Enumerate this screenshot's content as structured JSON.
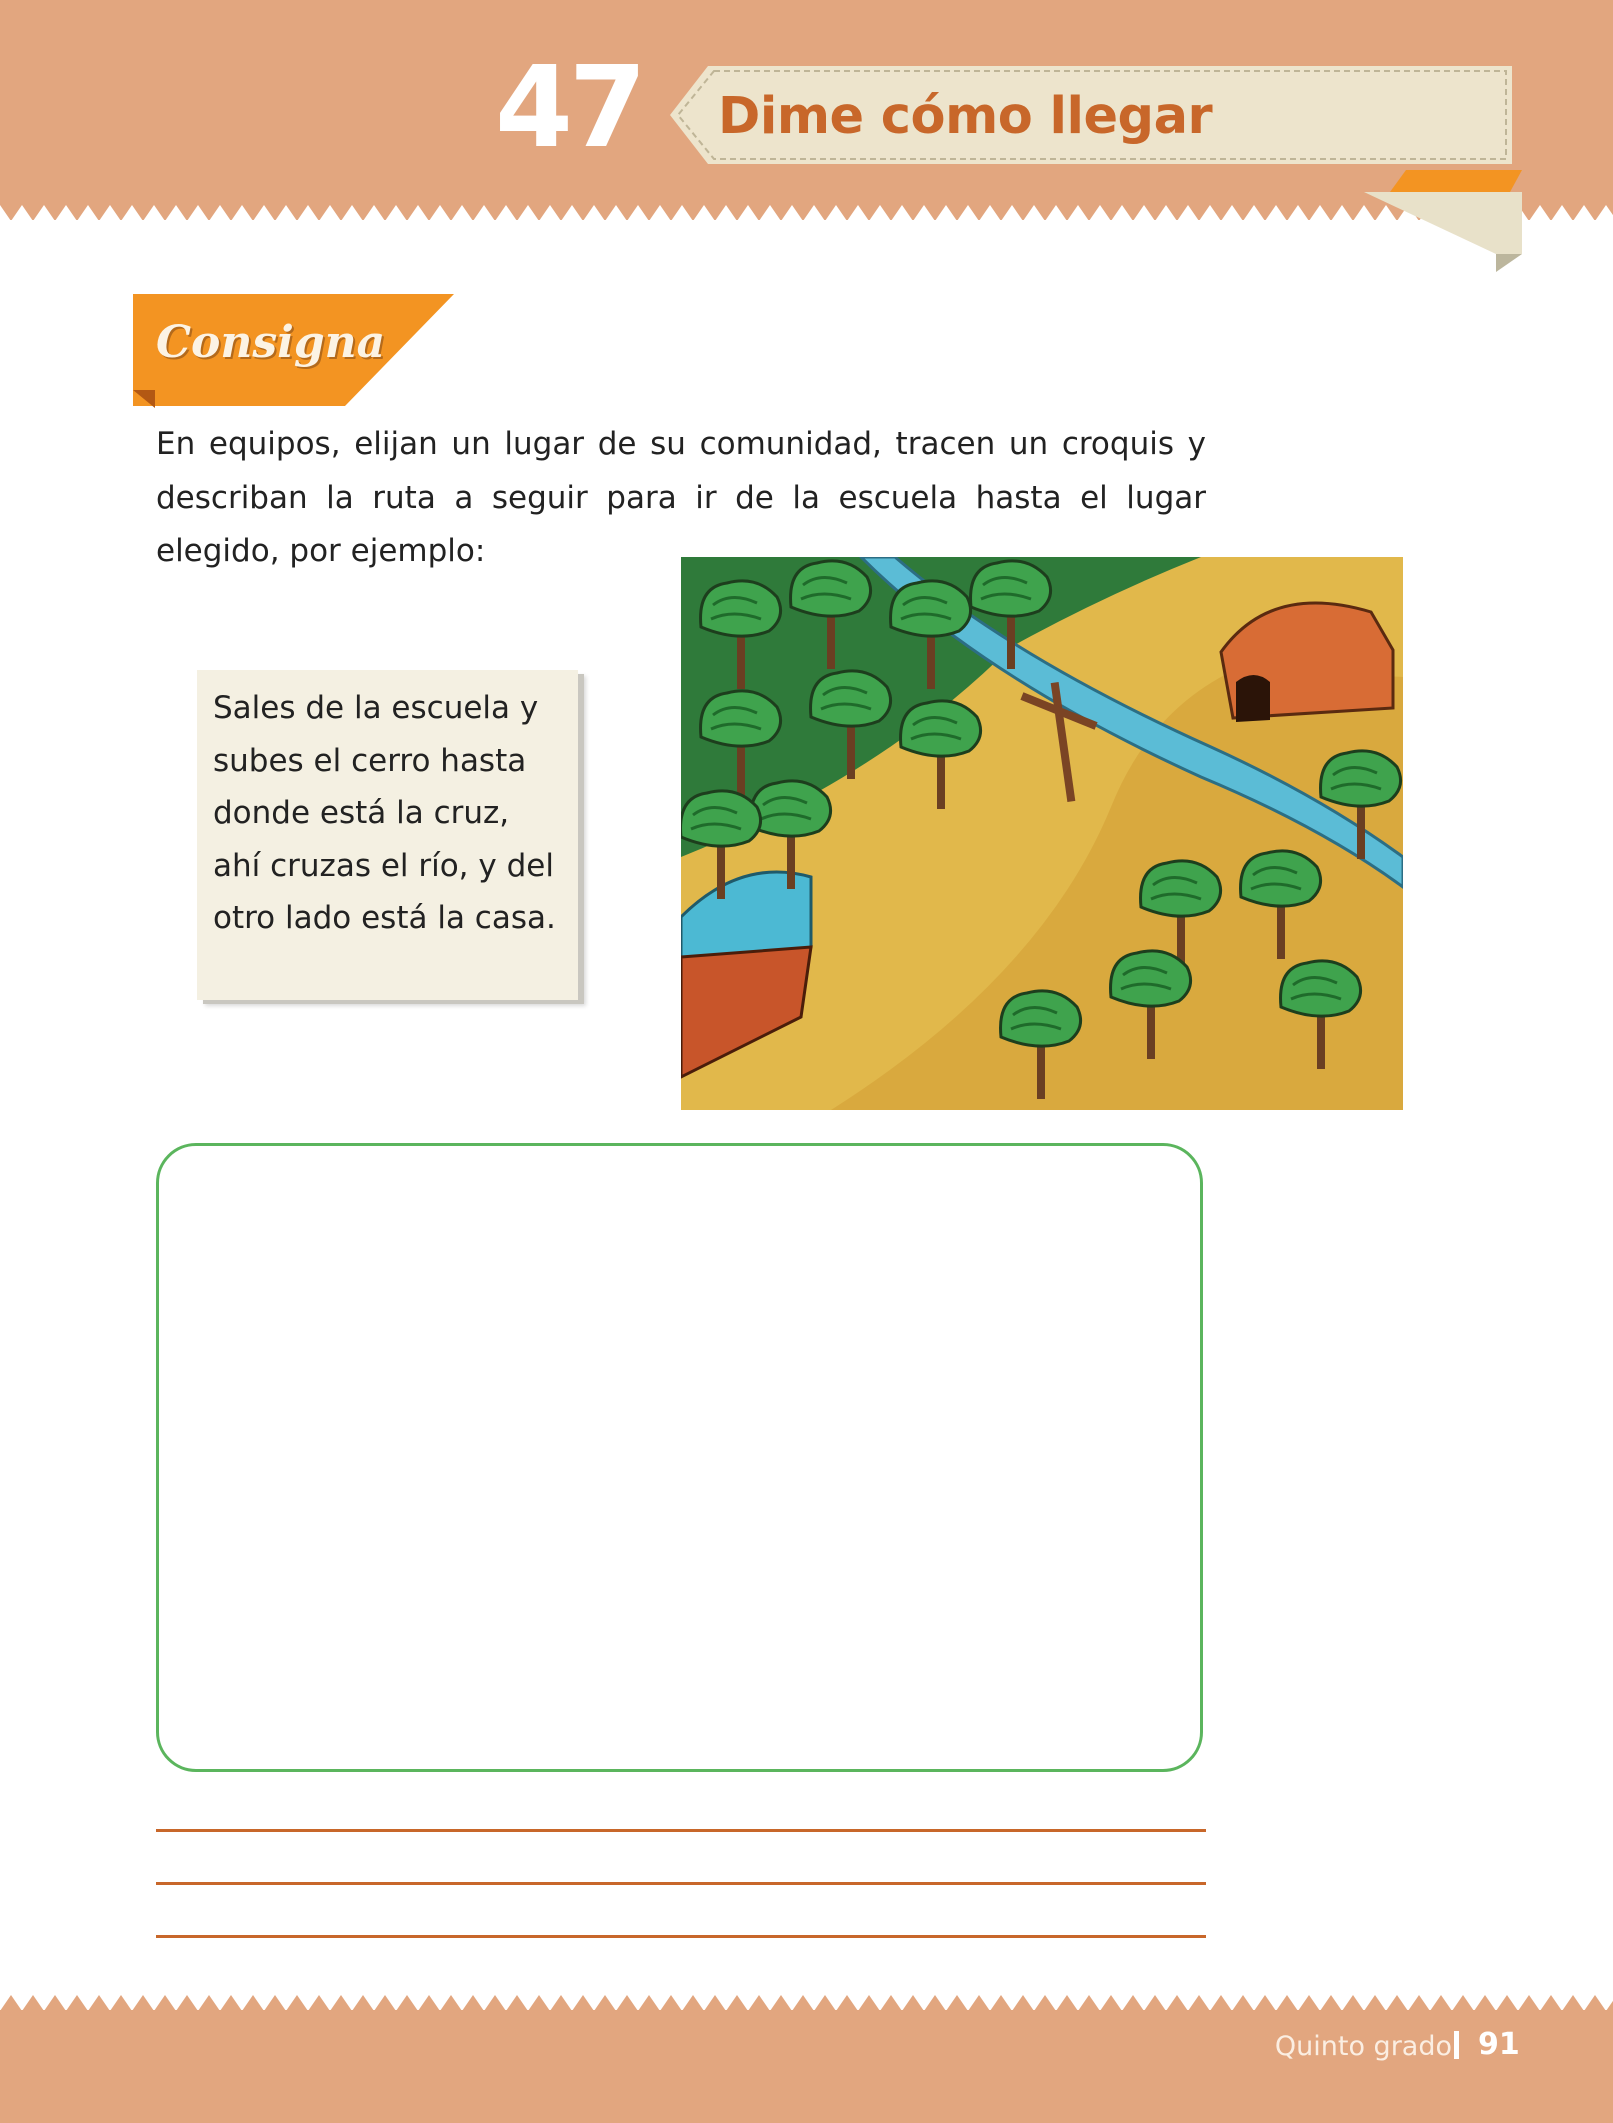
{
  "header": {
    "lesson_number": "47",
    "lesson_title": "Dime cómo llegar"
  },
  "consigna": {
    "label": "Consigna",
    "instruction": "En equipos, elijan un lugar de su comunidad, tracen un croquis y describan la ruta a seguir para ir de la escuela hasta el lugar elegido, por ejemplo:"
  },
  "example": {
    "text": "Sales de la escuela y subes el cerro hasta donde está la cruz, ahí cruzas el río, y del otro lado está la casa."
  },
  "answer_area": {
    "line_count": 3
  },
  "footer": {
    "grade": "Quinto grado",
    "page_number": "91"
  },
  "colors": {
    "band": "#e2a67f",
    "title": "#c8672a",
    "consigna_orange": "#f39422",
    "sketch_border": "#5bb55d",
    "answer_line": "#c8672a"
  }
}
